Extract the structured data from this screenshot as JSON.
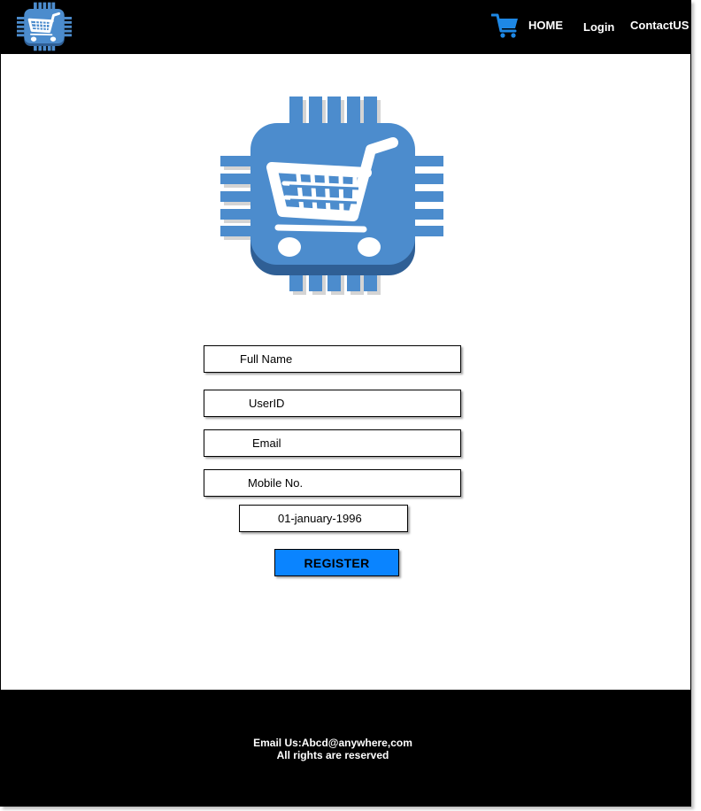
{
  "header": {
    "nav": {
      "home": "HOME",
      "login": "Login",
      "contact": "ContactUS"
    }
  },
  "form": {
    "full_name": "Full Name",
    "user_id": "UserID",
    "email": "Email",
    "mobile": "Mobile No.",
    "dob": "01-january-1996",
    "register_label": "REGISTER"
  },
  "footer": {
    "email_line": "Email Us:Abcd@anywhere,com",
    "rights_line": "All rights are reserved"
  },
  "colors": {
    "header_bg": "#000000",
    "logo_blue": "#4c8ccd",
    "register_bg": "#0a84ff",
    "cart_icon": "#1e88e5"
  },
  "icons": [
    "chip-cart-logo-icon",
    "shopping-cart-icon"
  ]
}
